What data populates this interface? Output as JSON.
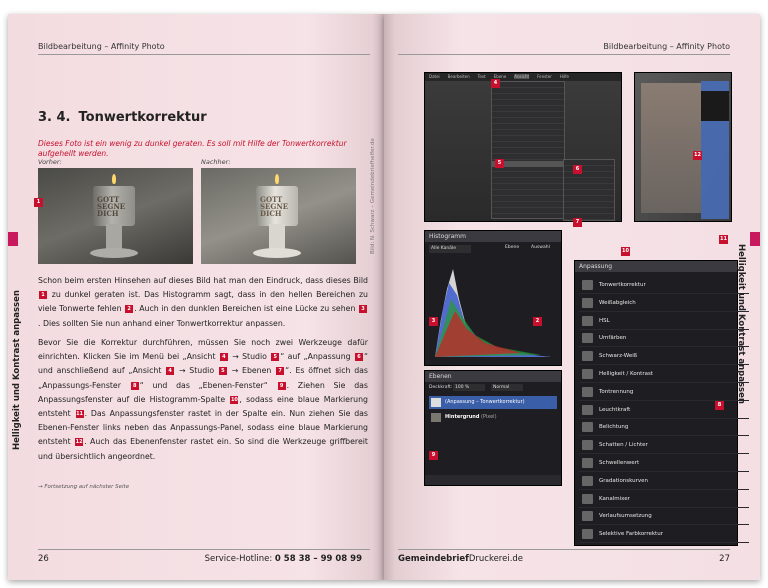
{
  "left_page": {
    "running_head": "Bildbearbeitung – Affinity Photo",
    "heading_number": "3. 4.",
    "heading_title": "Tonwertkorrektur",
    "intro": "Dieses Foto ist ein wenig zu dunkel geraten. Es soll mit Hilfe der Tonwertkorrektur aufgehellt werden.",
    "caption_before": "Vorher:",
    "caption_after": "Nachher:",
    "badge_photo": "1",
    "photo_text": "GOTT SEGNE DICH",
    "para1": "Schon beim ersten Hinsehen auf dieses Bild hat man den Eindruck, dass dieses Bild [1] zu dunkel geraten ist. Das Histogramm sagt, dass in den hellen Bereichen zu viele Tonwerte fehlen [2]. Auch in den dunklen Bereichen ist eine Lücke zu sehen [3]. Dies sollten Sie nun anhand einer Tonwertkorrektur anpassen.",
    "para2": "Bevor Sie die Korrektur durchführen, müssen Sie noch zwei Werkzeuge dafür einrichten. Klicken Sie im Menü bei „Ansicht [4] → Studio [5]“ auf „Anpassung [6]“ und anschließend auf „Ansicht [4] → Studio [5] → Ebenen [7]“. Es öffnet sich das „Anpassungs-Fenster [8]“ und das „Ebenen-Fenster“ [9]. Ziehen Sie das Anpassungsfenster auf die Histogramm-Spalte [10], sodass eine blaue Markierung entsteht [11]. Das Anpassungsfenster rastet in der Spalte ein. Nun ziehen Sie das Ebenen-Fenster links neben das Anpassungs-Panel, sodass eine blaue Markierung entsteht [12]. Auch das Ebenenfenster rastet ein. So sind die Werkzeuge griffbereit und übersichtlich angeordnet.",
    "continued": "→ Fortsetzung auf nächster Seite",
    "side_label": "Helligkeit und Kontrast anpassen",
    "spine_credit": "Bild: N. Schwarz – Gemeindebriefhelfer.de",
    "page_number": "26",
    "hotline_label": "Service-Hotline:",
    "hotline_number": "0 58 38 – 99 08 99"
  },
  "right_page": {
    "running_head": "Bildbearbeitung – Affinity Photo",
    "side_label": "Helligkeit und Kontrast anpassen",
    "brand_bold": "Gemeindebrief",
    "brand_rest": "Druckerei.de",
    "page_number": "27",
    "menu_shot": {
      "menubar": [
        "Datei",
        "Bearbeiten",
        "Text",
        "Ebene",
        "Ansicht",
        "Fenster",
        "Hilfe"
      ],
      "badges": [
        "4",
        "5",
        "6",
        "7"
      ]
    },
    "dock_shot": {
      "badges": [
        "12",
        "11"
      ]
    },
    "histogram": {
      "title": "Histogramm",
      "channel": "Alle Kanäle",
      "opt_layer": "Ebene",
      "opt_selection": "Auswahl",
      "badges": [
        "3",
        "2"
      ]
    },
    "layers": {
      "title": "Ebenen",
      "opacity_label": "Deckkraft:",
      "opacity_value": "100 %",
      "blend": "Normal",
      "layer1": "(Anpassung – Tonwertkorrektur)",
      "layer2_name": "Hintergrund",
      "layer2_type": "(Pixel)",
      "badge": "9"
    },
    "adjustments": {
      "title": "Anpassung",
      "badge_col": "10",
      "badge_panel": "8",
      "items": [
        "Tonwertkorrektur",
        "Weißabgleich",
        "HSL",
        "Umfärben",
        "Schwarz-Weiß",
        "Helligkeit / Kontrast",
        "Tontrennung",
        "Leuchtkraft",
        "Belichtung",
        "Schatten / Lichter",
        "Schwellenwert",
        "Gradationskurven",
        "Kanalmixer",
        "Verlaufsumsetzung",
        "Selektive Farbkorrektur"
      ]
    }
  }
}
